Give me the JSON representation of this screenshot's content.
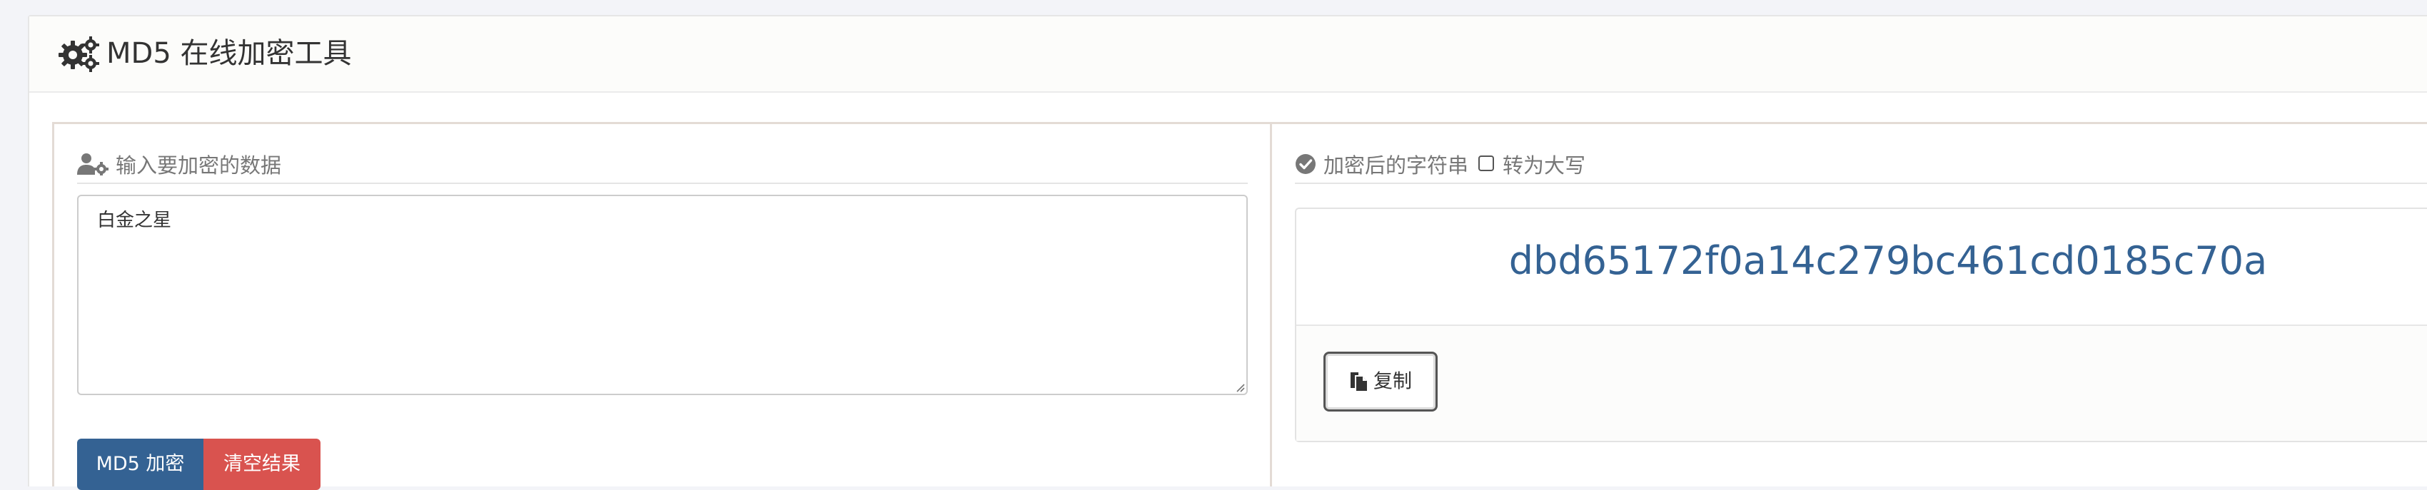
{
  "header": {
    "icon": "cogs-icon",
    "title": "MD5 在线加密工具"
  },
  "input_section": {
    "icon": "user-gear-icon",
    "legend": "输入要加密的数据",
    "textarea_value": "白金之星"
  },
  "buttons": {
    "encrypt_label": "MD5 加密",
    "clear_label": "清空结果"
  },
  "output_section": {
    "icon": "check-circle-icon",
    "legend": "加密后的字符串",
    "uppercase_checkbox_label": "转为大写",
    "uppercase_checked": false,
    "result": "dbd65172f0a14c279bc461cd0185c70a",
    "copy_icon": "copy-icon",
    "copy_label": "复制"
  },
  "colors": {
    "primary": "#346293",
    "danger": "#d9534f",
    "result_text": "#346293",
    "legend_text": "#777777",
    "page_background": "#f3f4f8"
  }
}
